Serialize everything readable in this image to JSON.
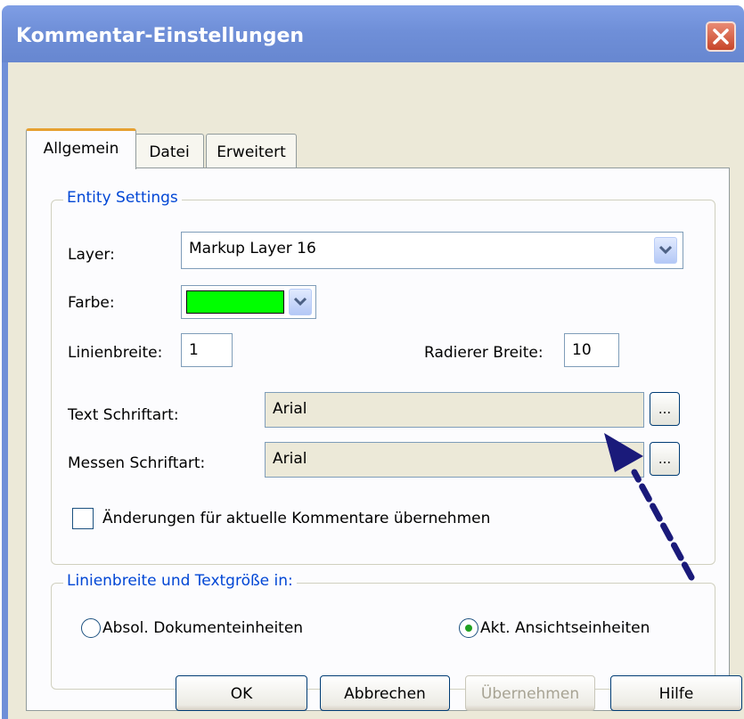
{
  "window": {
    "title": "Kommentar-Einstellungen"
  },
  "tabs": [
    {
      "label": "Allgemein",
      "active": true
    },
    {
      "label": "Datei",
      "active": false
    },
    {
      "label": "Erweitert",
      "active": false
    }
  ],
  "entity_settings": {
    "legend": "Entity Settings",
    "layer_label": "Layer:",
    "layer_value": "Markup Layer 16",
    "color_label": "Farbe:",
    "color_value": "#00ff00",
    "line_width_label": "Linienbreite:",
    "line_width_value": "1",
    "eraser_width_label": "Radierer Breite:",
    "eraser_width_value": "10",
    "text_font_label": "Text Schriftart:",
    "text_font_value": "Arial",
    "measure_font_label": "Messen Schriftart:",
    "measure_font_value": "Arial",
    "browse_label": "...",
    "apply_checkbox_label": "Änderungen für aktuelle Kommentare übernehmen",
    "apply_checked": false
  },
  "units": {
    "legend": "Linienbreite und Textgröße in:",
    "option_document": "Absol. Dokumenteinheiten",
    "option_view": "Akt. Ansichtseinheiten",
    "selected": "view"
  },
  "buttons": {
    "ok": "OK",
    "cancel": "Abbrechen",
    "apply": "Übernehmen",
    "help": "Hilfe"
  },
  "annotation": {
    "arrow_color": "#1a1a7a"
  }
}
